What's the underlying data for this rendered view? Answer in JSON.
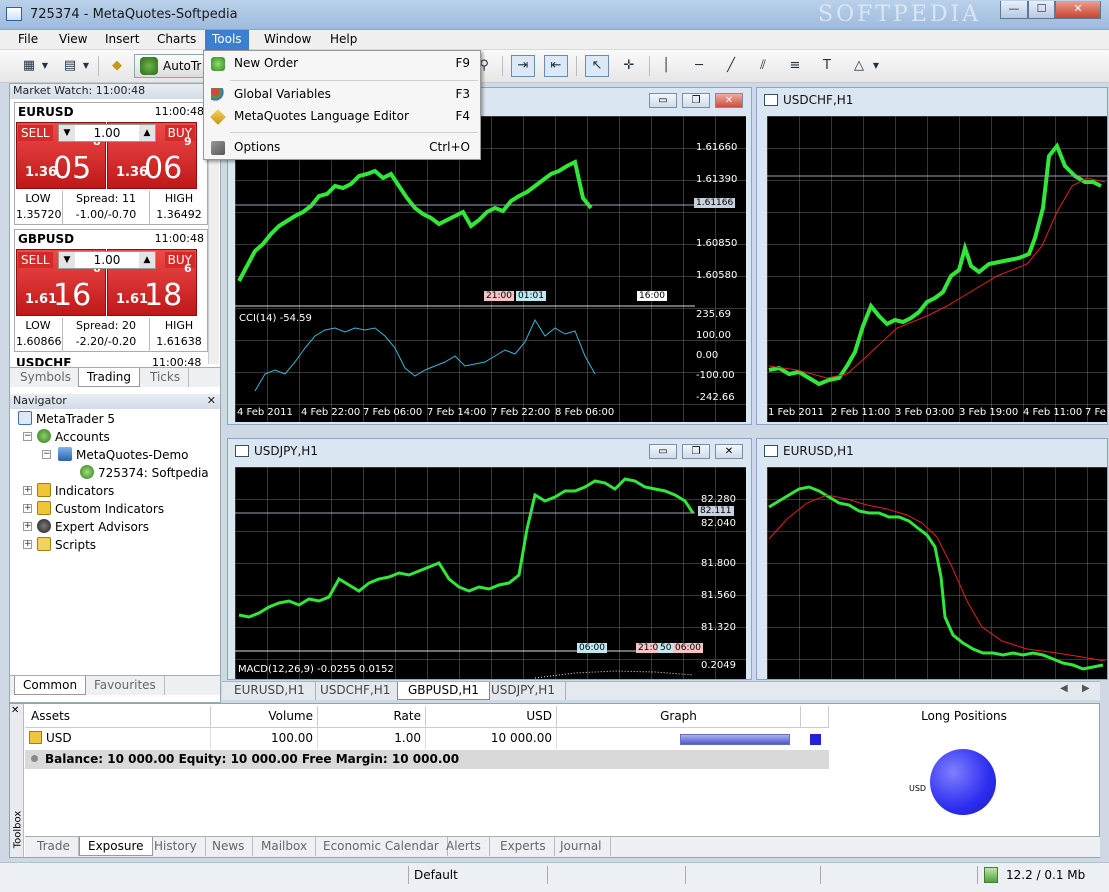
{
  "window": {
    "title": "725374 - MetaQuotes-Softpedia",
    "watermark": "SOFTPEDIA",
    "minimize": "—",
    "maximize": "☐",
    "close": "✕"
  },
  "menubar": [
    "File",
    "View",
    "Insert",
    "Charts",
    "Tools",
    "Window",
    "Help"
  ],
  "toolbar": {
    "autotrading_label": "AutoTr"
  },
  "tools_menu": [
    {
      "label": "New Order",
      "key": "F9"
    },
    {
      "label": "Global Variables",
      "key": "F3"
    },
    {
      "label": "MetaQuotes Language Editor",
      "key": "F4"
    },
    {
      "label": "Options",
      "key": "Ctrl+O"
    }
  ],
  "market_watch": {
    "header": "Market Watch: 11:00:48",
    "rows": [
      {
        "symbol": "EURUSD",
        "time": "11:00:48",
        "sell": "SELL",
        "buy": "BUY",
        "lot": "1.00",
        "sell_pre": "1.36",
        "sell_big": "05",
        "sell_sup": "8",
        "buy_pre": "1.36",
        "buy_big": "06",
        "buy_sup": "9",
        "low_label": "LOW",
        "low": "1.35720",
        "spread": "Spread: 11",
        "spread_range": "-1.00/-0.70",
        "high_label": "HIGH",
        "high": "1.36492"
      },
      {
        "symbol": "GBPUSD",
        "time": "11:00:48",
        "sell": "SELL",
        "buy": "BUY",
        "lot": "1.00",
        "sell_pre": "1.61",
        "sell_big": "16",
        "sell_sup": "6",
        "buy_pre": "1.61",
        "buy_big": "18",
        "buy_sup": "6",
        "low_label": "LOW",
        "low": "1.60866",
        "spread": "Spread: 20",
        "spread_range": "-2.20/-0.20",
        "high_label": "HIGH",
        "high": "1.61638"
      }
    ],
    "partial_row": {
      "symbol": "USDCHF",
      "time": "11:00:48"
    },
    "tabs": [
      "Symbols",
      "Trading",
      "Ticks"
    ]
  },
  "navigator": {
    "header": "Navigator",
    "items": [
      "MetaTrader 5",
      "Accounts",
      "MetaQuotes-Demo",
      "725374: Softpedia",
      "Indicators",
      "Custom Indicators",
      "Expert Advisors",
      "Scripts"
    ],
    "tabs": [
      "Common",
      "Favourites"
    ]
  },
  "charts": {
    "gbpusd": {
      "price_labels": [
        "1.61660",
        "1.61390",
        "1.61166",
        "1.60850",
        "1.60580"
      ],
      "time_tags": [
        "21:00",
        "01:01",
        "16:00"
      ],
      "cci_label": "CCI(14) -54.59",
      "cci_labels": [
        "235.69",
        "100.00",
        "0.00",
        "-100.00",
        "-242.66"
      ],
      "x_labels": [
        "4 Feb 2011",
        "4 Feb 22:00",
        "7 Feb 06:00",
        "7 Feb 14:00",
        "7 Feb 22:00",
        "8 Feb 06:00"
      ]
    },
    "usdchf": {
      "title": "USDCHF,H1",
      "x_labels": [
        "1 Feb 2011",
        "2 Feb 11:00",
        "3 Feb 03:00",
        "3 Feb 19:00",
        "4 Feb 11:00",
        "7 Fe"
      ]
    },
    "usdjpy": {
      "title": "USDJPY,H1",
      "price_labels": [
        "82.280",
        "82.111",
        "82.040",
        "81.800",
        "81.560",
        "81.320",
        "0.2049"
      ],
      "time_tags": [
        "06:00",
        "21:00",
        "50",
        "06:00"
      ],
      "macd_label": "MACD(12,26,9) -0.0255 0.0152"
    },
    "eurusd": {
      "title": "EURUSD,H1"
    }
  },
  "chart_tabs": [
    "EURUSD,H1",
    "USDCHF,H1",
    "GBPUSD,H1",
    "USDJPY,H1"
  ],
  "toolbox": {
    "side_label": "Toolbox",
    "headers": [
      "Assets",
      "Volume",
      "Rate",
      "USD",
      "Graph",
      "Long Positions"
    ],
    "row": {
      "asset": "USD",
      "volume": "100.00",
      "rate": "1.00",
      "usd": "10 000.00"
    },
    "balance": "Balance: 10 000.00  Equity: 10 000.00  Free Margin: 10 000.00",
    "pie_label": "USD",
    "tabs": [
      "Trade",
      "Exposure",
      "History",
      "News",
      "Mailbox",
      "Economic Calendar",
      "Alerts",
      "Experts",
      "Journal"
    ]
  },
  "status": {
    "profile": "Default",
    "traffic": "12.2 / 0.1 Mb"
  }
}
